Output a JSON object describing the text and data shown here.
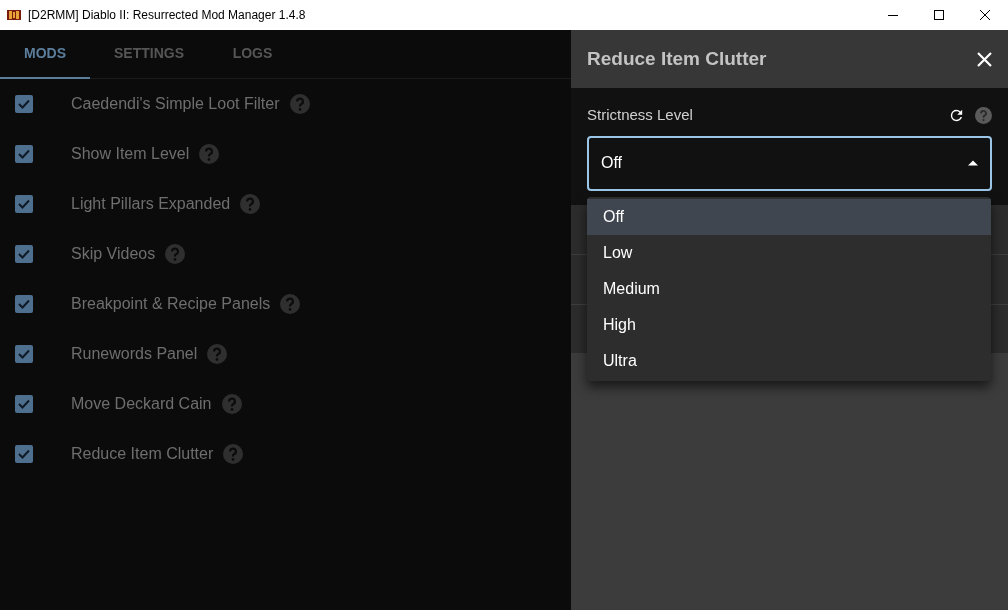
{
  "window": {
    "title": "[D2RMM] Diablo II: Resurrected Mod Manager 1.4.8"
  },
  "tabs": [
    {
      "label": "MODS",
      "selected": true
    },
    {
      "label": "SETTINGS",
      "selected": false
    },
    {
      "label": "LOGS",
      "selected": false
    }
  ],
  "mods": [
    {
      "label": "Caedendi's Simple Loot Filter",
      "checked": true
    },
    {
      "label": "Show Item Level",
      "checked": true
    },
    {
      "label": "Light Pillars Expanded",
      "checked": true
    },
    {
      "label": "Skip Videos",
      "checked": true
    },
    {
      "label": "Breakpoint & Recipe Panels",
      "checked": true
    },
    {
      "label": "Runewords Panel",
      "checked": true
    },
    {
      "label": "Move Deckard Cain",
      "checked": true
    },
    {
      "label": "Reduce Item Clutter",
      "checked": true
    }
  ],
  "drawer": {
    "title": "Reduce Item Clutter",
    "field": {
      "label": "Strictness Level",
      "value": "Off",
      "expanded": true,
      "options": [
        {
          "label": "Off",
          "selected": true
        },
        {
          "label": "Low",
          "selected": false
        },
        {
          "label": "Medium",
          "selected": false
        },
        {
          "label": "High",
          "selected": false
        },
        {
          "label": "Ultra",
          "selected": false
        }
      ]
    }
  }
}
